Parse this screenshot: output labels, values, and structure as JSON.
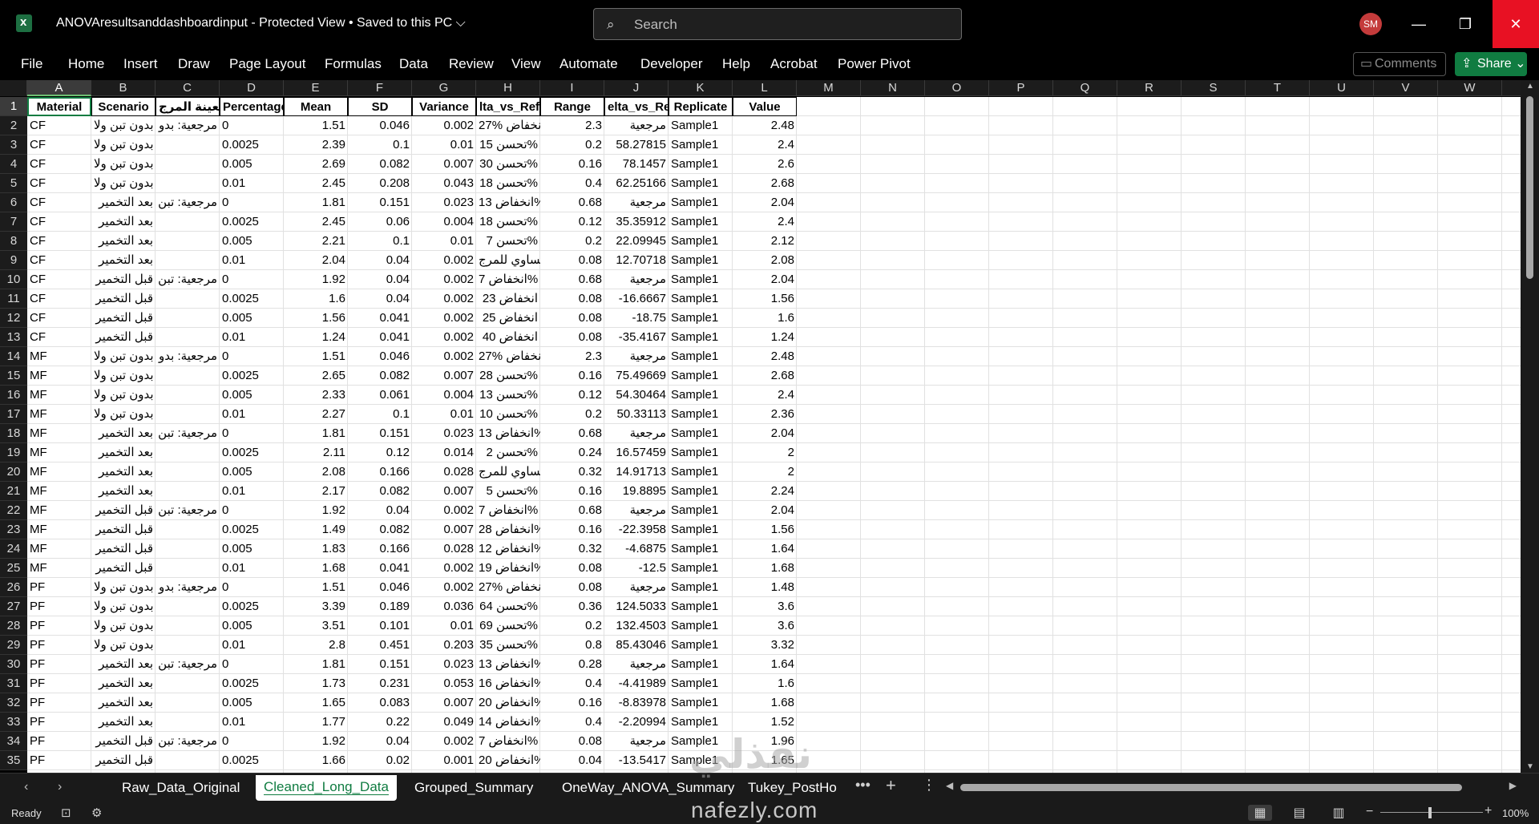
{
  "window": {
    "doc_title": "ANOVAresultsanddashboardinput  -  Protected View  •  Saved to this PC",
    "search_placeholder": "Search",
    "user_initials": "SM"
  },
  "ribbon": {
    "tabs": [
      "File",
      "Home",
      "Insert",
      "Draw",
      "Page Layout",
      "Formulas",
      "Data",
      "Review",
      "View",
      "Automate",
      "Developer",
      "Help",
      "Acrobat",
      "Power Pivot"
    ],
    "comments_label": "Comments",
    "share_label": "Share"
  },
  "grid": {
    "columns": [
      "A",
      "B",
      "C",
      "D",
      "E",
      "F",
      "G",
      "H",
      "I",
      "J",
      "K",
      "L",
      "M",
      "N",
      "O",
      "P",
      "Q",
      "R",
      "S",
      "T",
      "U",
      "V",
      "W"
    ],
    "header_row": [
      "Material",
      "Scenario",
      "ر العينة المرج",
      "Percentage",
      "Mean",
      "SD",
      "Variance",
      "lta_vs_Ref",
      "Range",
      "elta_vs_Re",
      "Replicate",
      "Value"
    ],
    "rows": [
      [
        "CF",
        "بدون تبن ولا",
        "مرجعية: بدو",
        "0",
        "1.51",
        "0.046",
        "0.002",
        "انخفاض %27",
        "2.3",
        "مرجعية",
        "Sample1",
        "2.48"
      ],
      [
        "CF",
        "بدون تبن ولا",
        "",
        "0.0025",
        "2.39",
        "0.1",
        "0.01",
        "تحسن 15%",
        "0.2",
        "58.27815",
        "Sample1",
        "2.4"
      ],
      [
        "CF",
        "بدون تبن ولا",
        "",
        "0.005",
        "2.69",
        "0.082",
        "0.007",
        "تحسن 30%",
        "0.16",
        "78.1457",
        "Sample1",
        "2.6"
      ],
      [
        "CF",
        "بدون تبن ولا",
        "",
        "0.01",
        "2.45",
        "0.208",
        "0.043",
        "تحسن 18%",
        "0.4",
        "62.25166",
        "Sample1",
        "2.68"
      ],
      [
        "CF",
        "بعد التخمير",
        "مرجعية: تبن",
        "0",
        "1.81",
        "0.151",
        "0.023",
        "انخفاض 13%",
        "0.68",
        "مرجعية",
        "Sample1",
        "2.04"
      ],
      [
        "CF",
        "بعد التخمير",
        "",
        "0.0025",
        "2.45",
        "0.06",
        "0.004",
        "تحسن 18%",
        "0.12",
        "35.35912",
        "Sample1",
        "2.4"
      ],
      [
        "CF",
        "بعد التخمير",
        "",
        "0.005",
        "2.21",
        "0.1",
        "0.01",
        "تحسن 7%",
        "0.2",
        "22.09945",
        "Sample1",
        "2.12"
      ],
      [
        "CF",
        "بعد التخمير",
        "",
        "0.01",
        "2.04",
        "0.04",
        "0.002",
        "مساوي للمرج",
        "0.08",
        "12.70718",
        "Sample1",
        "2.08"
      ],
      [
        "CF",
        "قبل التخمير",
        "مرجعية: تبن",
        "0",
        "1.92",
        "0.04",
        "0.002",
        "انخفاض 7%",
        "0.68",
        "مرجعية",
        "Sample1",
        "2.04"
      ],
      [
        "CF",
        "قبل التخمير",
        "",
        "0.0025",
        "1.6",
        "0.04",
        "0.002",
        "انخفاض 23",
        "0.08",
        "-16.6667",
        "Sample1",
        "1.56"
      ],
      [
        "CF",
        "قبل التخمير",
        "",
        "0.005",
        "1.56",
        "0.041",
        "0.002",
        "انخفاض 25",
        "0.08",
        "-18.75",
        "Sample1",
        "1.6"
      ],
      [
        "CF",
        "قبل التخمير",
        "",
        "0.01",
        "1.24",
        "0.041",
        "0.002",
        "انخفاض 40",
        "0.08",
        "-35.4167",
        "Sample1",
        "1.24"
      ],
      [
        "MF",
        "بدون تبن ولا",
        "مرجعية: بدو",
        "0",
        "1.51",
        "0.046",
        "0.002",
        "انخفاض %27",
        "2.3",
        "مرجعية",
        "Sample1",
        "2.48"
      ],
      [
        "MF",
        "بدون تبن ولا",
        "",
        "0.0025",
        "2.65",
        "0.082",
        "0.007",
        "تحسن 28%",
        "0.16",
        "75.49669",
        "Sample1",
        "2.68"
      ],
      [
        "MF",
        "بدون تبن ولا",
        "",
        "0.005",
        "2.33",
        "0.061",
        "0.004",
        "تحسن 13%",
        "0.12",
        "54.30464",
        "Sample1",
        "2.4"
      ],
      [
        "MF",
        "بدون تبن ولا",
        "",
        "0.01",
        "2.27",
        "0.1",
        "0.01",
        "تحسن 10%",
        "0.2",
        "50.33113",
        "Sample1",
        "2.36"
      ],
      [
        "MF",
        "بعد التخمير",
        "مرجعية: تبن",
        "0",
        "1.81",
        "0.151",
        "0.023",
        "انخفاض 13%",
        "0.68",
        "مرجعية",
        "Sample1",
        "2.04"
      ],
      [
        "MF",
        "بعد التخمير",
        "",
        "0.0025",
        "2.11",
        "0.12",
        "0.014",
        "تحسن 2%",
        "0.24",
        "16.57459",
        "Sample1",
        "2"
      ],
      [
        "MF",
        "بعد التخمير",
        "",
        "0.005",
        "2.08",
        "0.166",
        "0.028",
        "مساوي للمرج",
        "0.32",
        "14.91713",
        "Sample1",
        "2"
      ],
      [
        "MF",
        "بعد التخمير",
        "",
        "0.01",
        "2.17",
        "0.082",
        "0.007",
        "تحسن 5%",
        "0.16",
        "19.8895",
        "Sample1",
        "2.24"
      ],
      [
        "MF",
        "قبل التخمير",
        "مرجعية: تبن",
        "0",
        "1.92",
        "0.04",
        "0.002",
        "انخفاض 7%",
        "0.68",
        "مرجعية",
        "Sample1",
        "2.04"
      ],
      [
        "MF",
        "قبل التخمير",
        "",
        "0.0025",
        "1.49",
        "0.082",
        "0.007",
        "انخفاض 28%",
        "0.16",
        "-22.3958",
        "Sample1",
        "1.56"
      ],
      [
        "MF",
        "قبل التخمير",
        "",
        "0.005",
        "1.83",
        "0.166",
        "0.028",
        "انخفاض 12%",
        "0.32",
        "-4.6875",
        "Sample1",
        "1.64"
      ],
      [
        "MF",
        "قبل التخمير",
        "",
        "0.01",
        "1.68",
        "0.041",
        "0.002",
        "انخفاض 19%",
        "0.08",
        "-12.5",
        "Sample1",
        "1.68"
      ],
      [
        "PF",
        "بدون تبن ولا",
        "مرجعية: بدو",
        "0",
        "1.51",
        "0.046",
        "0.002",
        "انخفاض %27",
        "0.08",
        "مرجعية",
        "Sample1",
        "1.48"
      ],
      [
        "PF",
        "بدون تبن ولا",
        "",
        "0.0025",
        "3.39",
        "0.189",
        "0.036",
        "تحسن 64%",
        "0.36",
        "124.5033",
        "Sample1",
        "3.6"
      ],
      [
        "PF",
        "بدون تبن ولا",
        "",
        "0.005",
        "3.51",
        "0.101",
        "0.01",
        "تحسن 69%",
        "0.2",
        "132.4503",
        "Sample1",
        "3.6"
      ],
      [
        "PF",
        "بدون تبن ولا",
        "",
        "0.01",
        "2.8",
        "0.451",
        "0.203",
        "تحسن 35%",
        "0.8",
        "85.43046",
        "Sample1",
        "3.32"
      ],
      [
        "PF",
        "بعد التخمير",
        "مرجعية: تبن",
        "0",
        "1.81",
        "0.151",
        "0.023",
        "انخفاض 13%",
        "0.28",
        "مرجعية",
        "Sample1",
        "1.64"
      ],
      [
        "PF",
        "بعد التخمير",
        "",
        "0.0025",
        "1.73",
        "0.231",
        "0.053",
        "انخفاض 16%",
        "0.4",
        "-4.41989",
        "Sample1",
        "1.6"
      ],
      [
        "PF",
        "بعد التخمير",
        "",
        "0.005",
        "1.65",
        "0.083",
        "0.007",
        "انخفاض 20%",
        "0.16",
        "-8.83978",
        "Sample1",
        "1.68"
      ],
      [
        "PF",
        "بعد التخمير",
        "",
        "0.01",
        "1.77",
        "0.22",
        "0.049",
        "انخفاض 14%",
        "0.4",
        "-2.20994",
        "Sample1",
        "1.52"
      ],
      [
        "PF",
        "قبل التخمير",
        "مرجعية: تبن",
        "0",
        "1.92",
        "0.04",
        "0.002",
        "انخفاض 7%",
        "0.08",
        "مرجعية",
        "Sample1",
        "1.96"
      ],
      [
        "PF",
        "قبل التخمير",
        "",
        "0.0025",
        "1.66",
        "0.02",
        "0.001",
        "انخفاض 20%",
        "0.04",
        "-13.5417",
        "Sample1",
        "1.65"
      ]
    ]
  },
  "sheets": {
    "tabs": [
      "Raw_Data_Original",
      "Cleaned_Long_Data",
      "Grouped_Summary",
      "OneWay_ANOVA_Summary",
      "Tukey_PostHo"
    ],
    "active": "Cleaned_Long_Data"
  },
  "status": {
    "ready": "Ready",
    "zoom": "100%"
  },
  "watermark": {
    "logo": "نفذلي",
    "site": "nafezly.com"
  }
}
